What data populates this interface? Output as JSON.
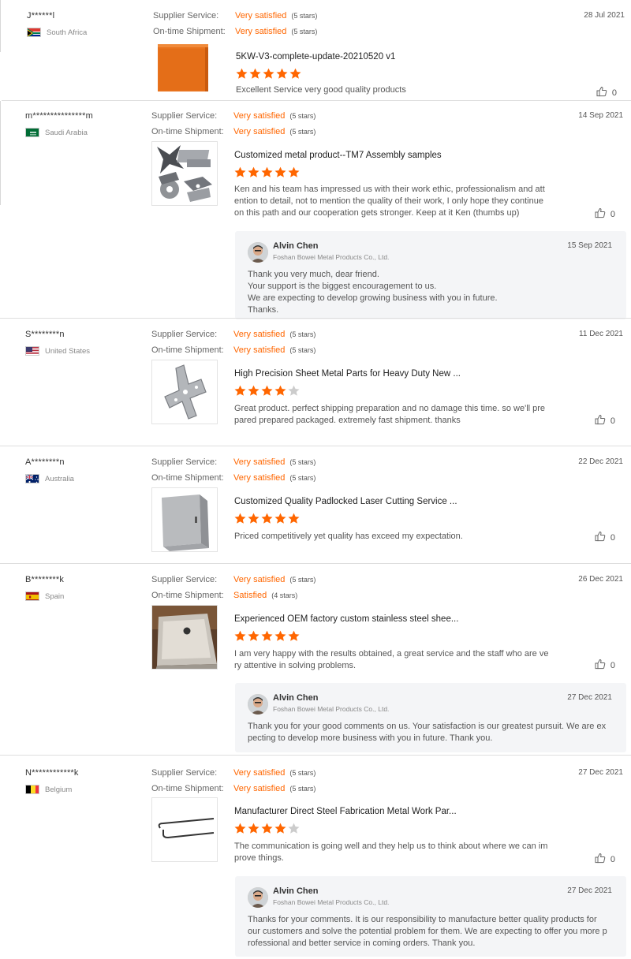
{
  "labels": {
    "supplier_service": "Supplier Service:",
    "on_time_shipment": "On-time Shipment:"
  },
  "colors": {
    "accent": "#ff6600",
    "star_empty": "#cccccc"
  },
  "reviews": [
    {
      "user": "J******l",
      "country": "South Africa",
      "flag": "za",
      "date": "28 Jul 2021",
      "supplier_service": {
        "value": "Very satisfied",
        "stars": "(5 stars)"
      },
      "on_time_shipment": {
        "value": "Very satisfied",
        "stars": "(5 stars)"
      },
      "product_title": "5KW-V3-complete-update-20210520 v1",
      "rating": 5,
      "text": [
        "Excellent Service very good quality products"
      ],
      "likes": "0",
      "thumb": "orange-cabinet"
    },
    {
      "user": "m***************m",
      "country": "Saudi Arabia",
      "flag": "sa",
      "date": "14 Sep 2021",
      "supplier_service": {
        "value": "Very satisfied",
        "stars": "(5 stars)"
      },
      "on_time_shipment": {
        "value": "Very satisfied",
        "stars": "(5 stars)"
      },
      "product_title": "Customized metal product--TM7 Assembly samples",
      "rating": 5,
      "text": [
        "Ken and his team has impressed us with their work ethic, professionalism and att",
        "ention to detail, not to mention the quality of their work, I only hope they continue",
        "on this path and our cooperation gets stronger. Keep at it Ken (thumbs up)"
      ],
      "likes": "0",
      "thumb": "metal-parts",
      "reply": {
        "name": "Alvin Chen",
        "company": "Foshan Bowei Metal Products Co., Ltd.",
        "date": "15 Sep 2021",
        "text": [
          "Thank you very much, dear friend.",
          "Your support is the biggest encouragement to us.",
          "We are expecting to develop growing business with you in future.",
          "Thanks."
        ]
      }
    },
    {
      "user": "S********n",
      "country": "United States",
      "flag": "us",
      "date": "11 Dec 2021",
      "supplier_service": {
        "value": "Very satisfied",
        "stars": "(5 stars)"
      },
      "on_time_shipment": {
        "value": "Very satisfied",
        "stars": "(5 stars)"
      },
      "product_title": "High Precision Sheet Metal Parts for Heavy Duty New ...",
      "rating": 4,
      "text": [
        "Great product. perfect shipping preparation and no damage this time. so we'll pre",
        "pared prepared packaged. extremely fast shipment. thanks"
      ],
      "likes": "0",
      "thumb": "bracket"
    },
    {
      "user": "A********n",
      "country": "Australia",
      "flag": "au",
      "date": "22 Dec 2021",
      "supplier_service": {
        "value": "Very satisfied",
        "stars": "(5 stars)"
      },
      "on_time_shipment": {
        "value": "Very satisfied",
        "stars": "(5 stars)"
      },
      "product_title": "Customized Quality Padlocked Laser Cutting Service ...",
      "rating": 5,
      "text": [
        "Priced competitively yet quality has exceed my expectation."
      ],
      "likes": "0",
      "thumb": "box"
    },
    {
      "user": "B********k",
      "country": "Spain",
      "flag": "es",
      "date": "26 Dec 2021",
      "supplier_service": {
        "value": "Very satisfied",
        "stars": "(5 stars)"
      },
      "on_time_shipment": {
        "value": "Satisfied",
        "stars": "(4 stars)"
      },
      "product_title": "Experienced OEM factory custom stainless steel shee...",
      "rating": 5,
      "text": [
        "I am very happy with the results obtained, a great service and the staff who are ve",
        "ry attentive in solving problems."
      ],
      "likes": "0",
      "thumb": "tray",
      "reply": {
        "name": "Alvin Chen",
        "company": "Foshan Bowei Metal Products Co., Ltd.",
        "date": "27 Dec 2021",
        "text": [
          "Thank you for your good comments on us. Your satisfaction is our greatest pursuit. We are ex",
          "pecting to develop more business with you in future. Thank you."
        ]
      }
    },
    {
      "user": "N************k",
      "country": "Belgium",
      "flag": "be",
      "date": "27 Dec 2021",
      "supplier_service": {
        "value": "Very satisfied",
        "stars": "(5 stars)"
      },
      "on_time_shipment": {
        "value": "Very satisfied",
        "stars": "(5 stars)"
      },
      "product_title": "Manufacturer Direct Steel Fabrication Metal Work Par...",
      "rating": 4,
      "text": [
        "The communication is going well and they help us to think about where we can im",
        "prove things."
      ],
      "likes": "0",
      "thumb": "wire",
      "reply": {
        "name": "Alvin Chen",
        "company": "Foshan Bowei Metal Products Co., Ltd.",
        "date": "27 Dec 2021",
        "text": [
          "Thanks for your comments.  It is our responsibility to manufacture better quality products for",
          "our customers and solve the potential problem for them. We are expecting to offer you more p",
          "rofessional and better service in coming orders. Thank you."
        ]
      }
    }
  ]
}
